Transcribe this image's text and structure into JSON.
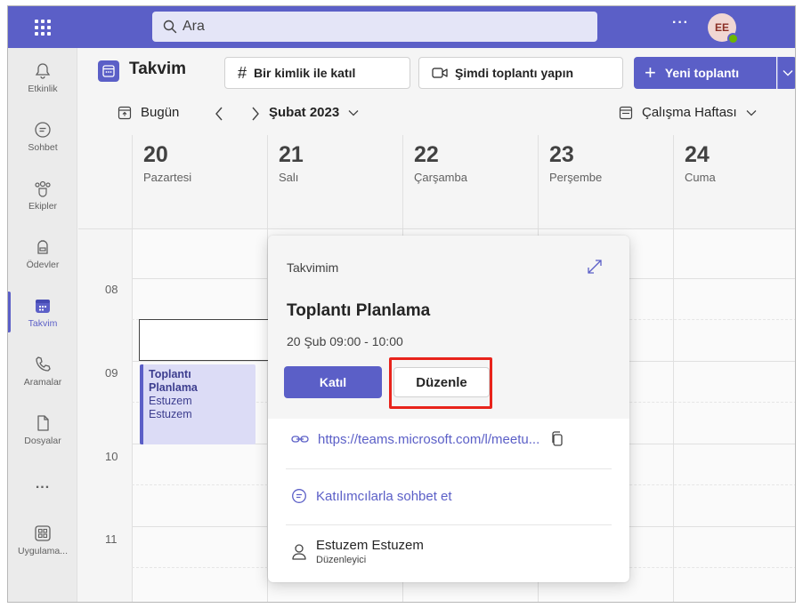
{
  "topbar": {
    "search_placeholder": "Ara",
    "more": "···",
    "avatar_initials": "EE",
    "accent": "#5b5fc7"
  },
  "rail": {
    "items": [
      {
        "label": "Etkinlik",
        "icon": "bell-icon"
      },
      {
        "label": "Sohbet",
        "icon": "chat-icon"
      },
      {
        "label": "Ekipler",
        "icon": "teams-icon"
      },
      {
        "label": "Ödevler",
        "icon": "backpack-icon"
      },
      {
        "label": "Takvim",
        "icon": "calendar-icon",
        "active": true
      },
      {
        "label": "Aramalar",
        "icon": "phone-icon"
      },
      {
        "label": "Dosyalar",
        "icon": "file-icon"
      },
      {
        "label": "...",
        "icon": "more-icon"
      },
      {
        "label": "Uygulama...",
        "icon": "apps-icon"
      }
    ]
  },
  "header": {
    "title": "Takvim",
    "join_with_id": "Bir kimlik ile katıl",
    "meet_now": "Şimdi toplantı yapın",
    "new_meeting": "Yeni toplantı"
  },
  "nav": {
    "today": "Bugün",
    "month": "Şubat 2023",
    "view": "Çalışma Haftası"
  },
  "days": [
    {
      "num": "20",
      "name": "Pazartesi"
    },
    {
      "num": "21",
      "name": "Salı"
    },
    {
      "num": "22",
      "name": "Çarşamba"
    },
    {
      "num": "23",
      "name": "Perşembe"
    },
    {
      "num": "24",
      "name": "Cuma"
    }
  ],
  "hours": [
    "08",
    "09",
    "10",
    "11"
  ],
  "event": {
    "title_line1": "Toplantı",
    "title_line2": "Planlama",
    "line3": "Estuzem",
    "line4": "Estuzem"
  },
  "popup": {
    "calendar": "Takvimim",
    "title": "Toplantı Planlama",
    "time": "20 Şub 09:00 - 10:00",
    "join": "Katıl",
    "edit": "Düzenle",
    "link": "https://teams.microsoft.com/l/meetu...",
    "chat": "Katılımcılarla sohbet et",
    "organizer_name": "Estuzem Estuzem",
    "organizer_role": "Düzenleyici"
  }
}
